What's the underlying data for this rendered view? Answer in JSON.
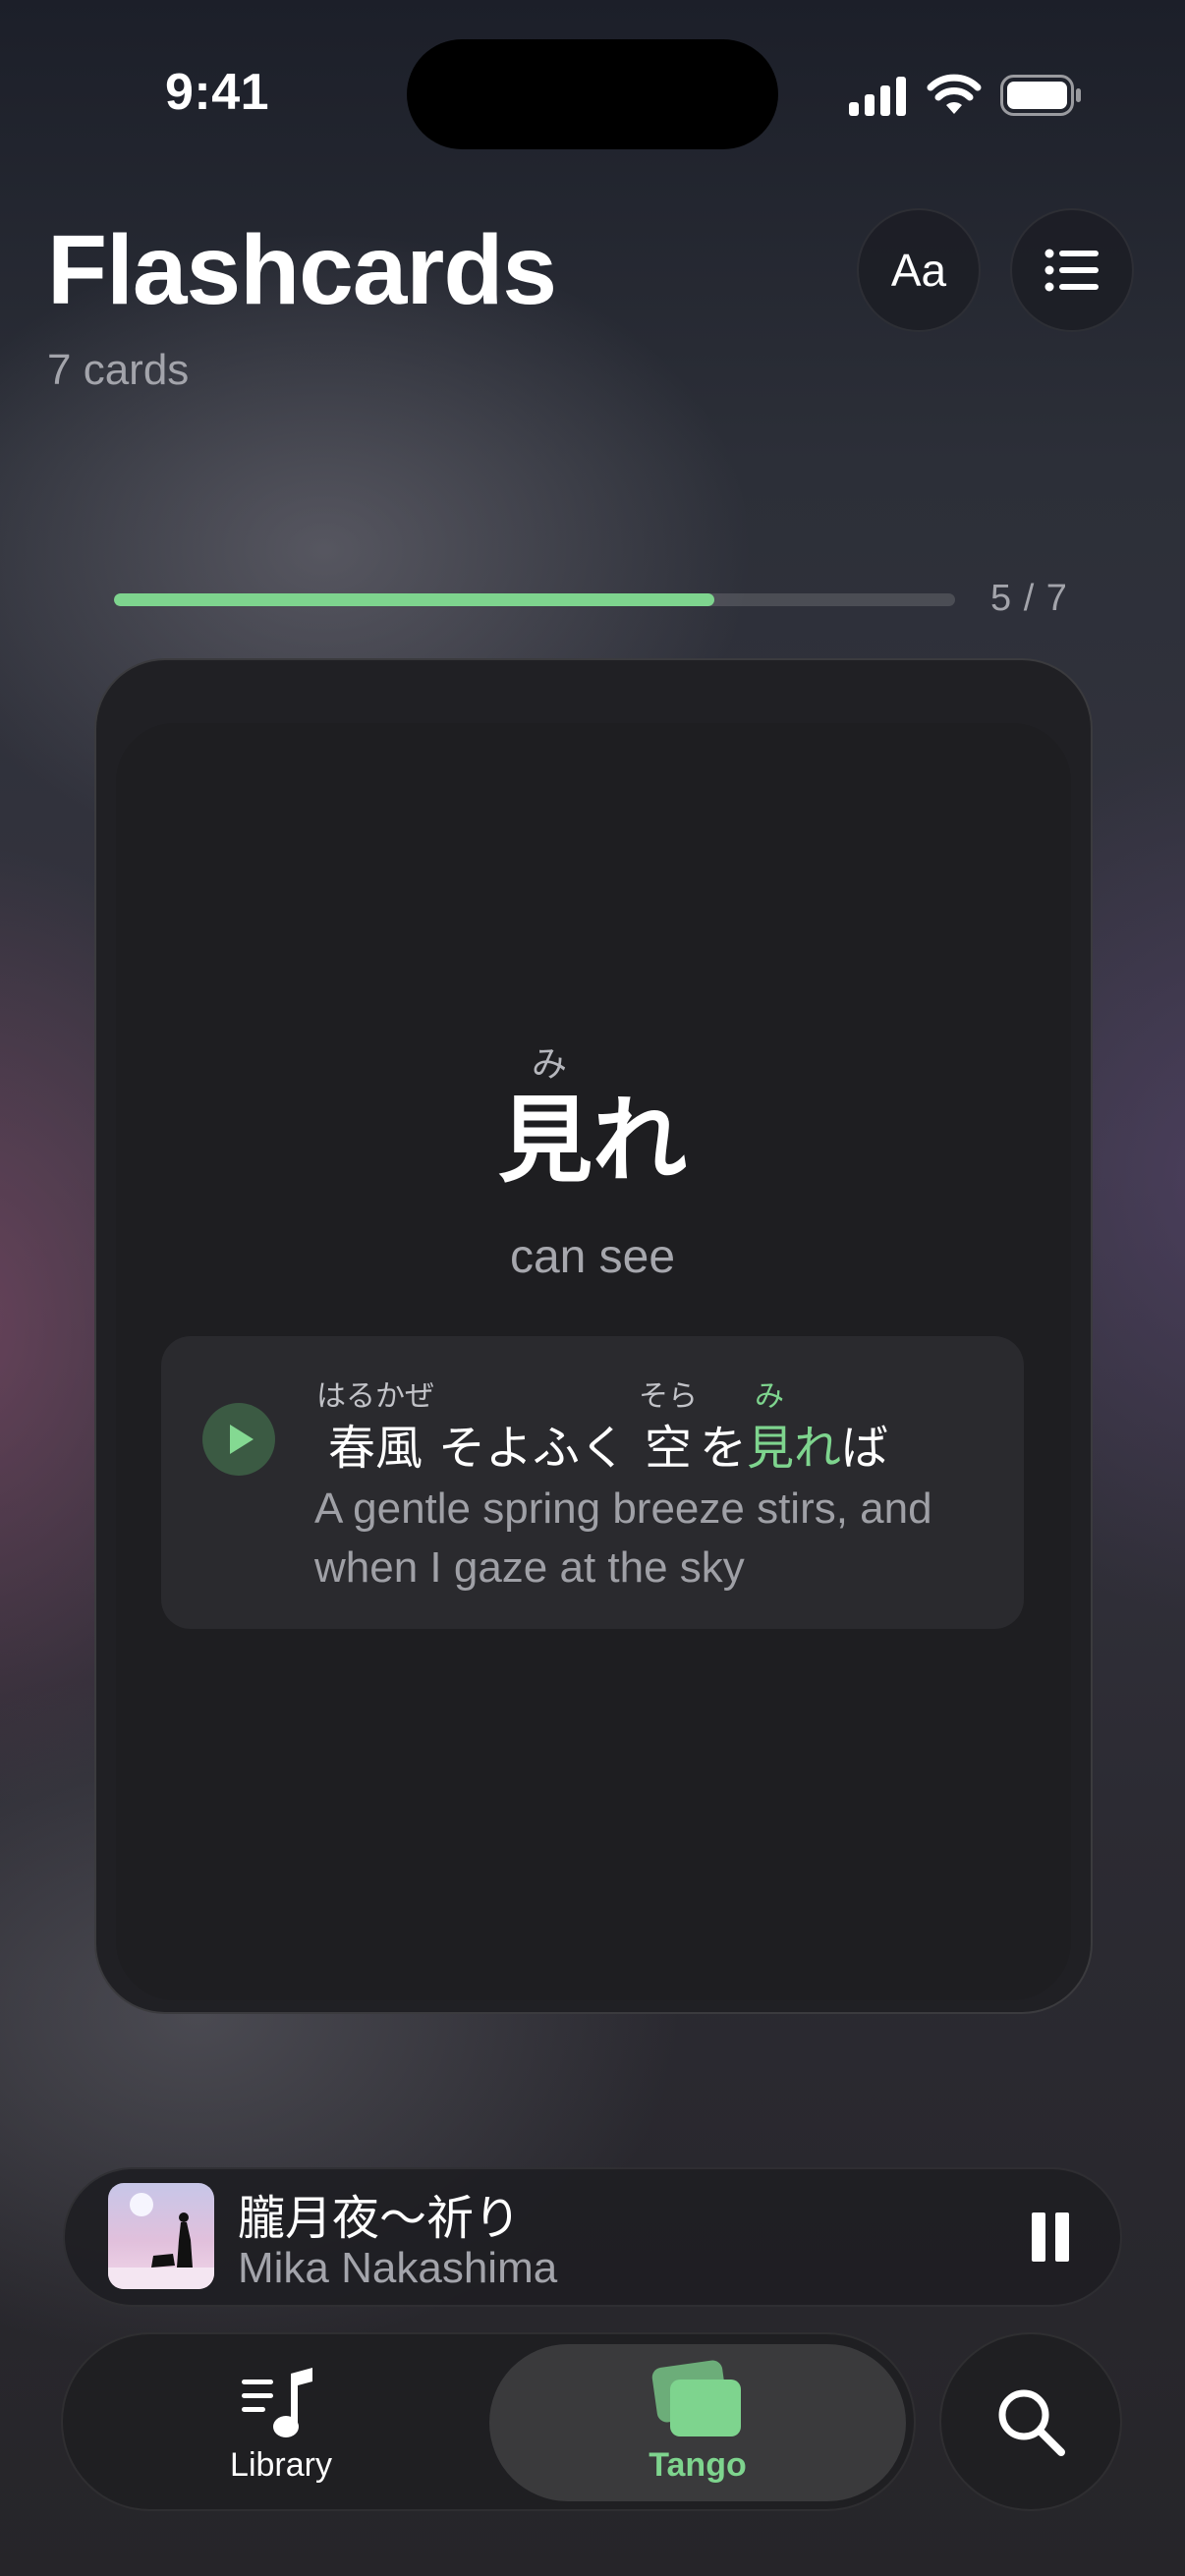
{
  "status_bar": {
    "time": "9:41"
  },
  "header": {
    "title": "Flashcards",
    "count": "7 cards",
    "font_button_label": "Aa"
  },
  "progress": {
    "text": "5 / 7",
    "fraction": 0.714
  },
  "card": {
    "reading": "み",
    "word": "見れ",
    "meaning": "can see",
    "example": {
      "segments": [
        {
          "furigana": "はるかぜ",
          "text": "春風"
        },
        {
          "furigana": "",
          "text": "そよふく"
        },
        {
          "furigana": "そら",
          "text": "空"
        },
        {
          "furigana": "",
          "text": "を"
        },
        {
          "furigana": "み",
          "text": "見れ"
        },
        {
          "furigana": "",
          "text": "ば"
        }
      ],
      "translation": "A gentle spring breeze stirs, and when I gaze at the sky"
    }
  },
  "now_playing": {
    "song": "朧月夜〜祈り",
    "artist": "Mika Nakashima"
  },
  "tabs": {
    "library": "Library",
    "tango": "Tango"
  },
  "colors": {
    "accent": "#7ed48e",
    "card": "#1e1e21",
    "example_bg": "#2a2a2e"
  },
  "icons": [
    "signal-icon",
    "wifi-icon",
    "battery-icon",
    "list-icon",
    "play-icon",
    "pause-icon",
    "music-note-icon",
    "cards-icon",
    "search-icon"
  ]
}
